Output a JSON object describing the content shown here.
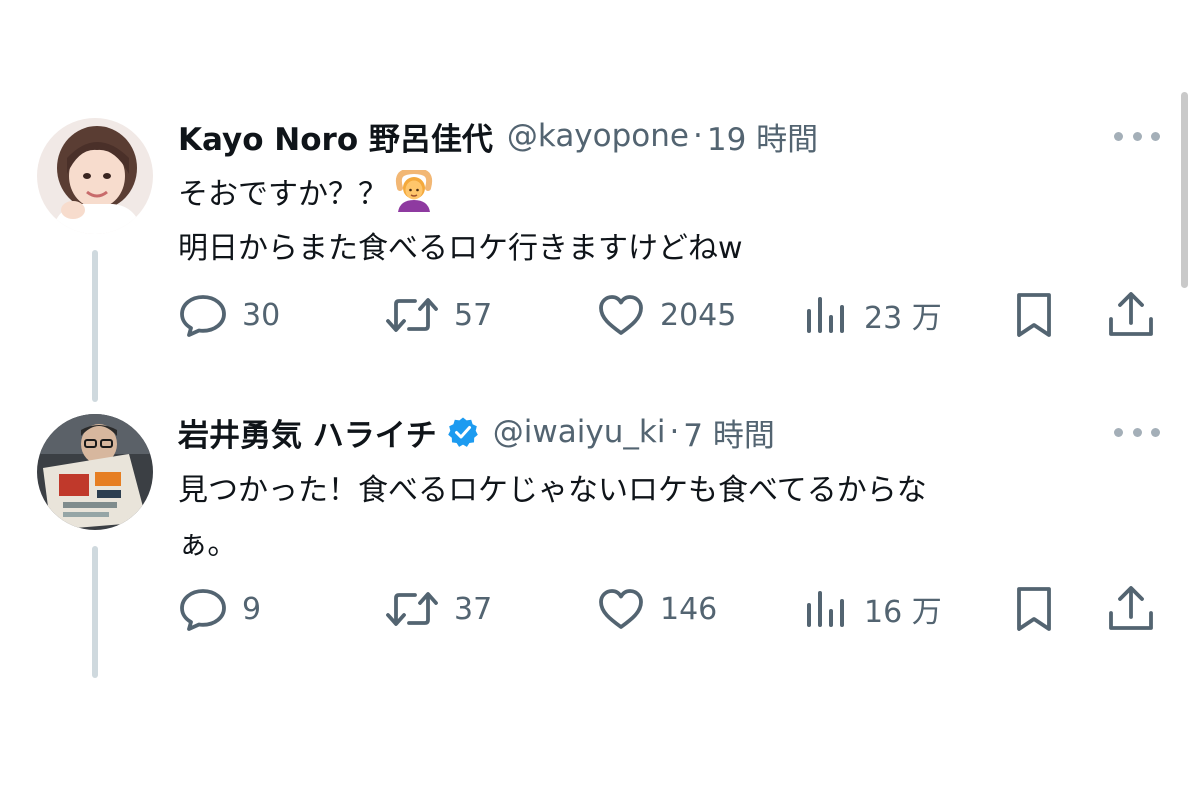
{
  "colors": {
    "text": "#0f1419",
    "secondary": "#536471",
    "verified": "#1d9bf0",
    "thread_line": "#cfd9de"
  },
  "tweets": [
    {
      "display_name": "Kayo Noro 野呂佳代",
      "handle": "@kayopone",
      "separator": "·",
      "time": "19 時間",
      "verified": false,
      "text_lines": [
        "そおですか？？",
        "明日からまた食べるロケ行きますけどねw"
      ],
      "emoji": "woman-gesturing-ok-emoji",
      "actions": {
        "replies": "30",
        "reposts": "57",
        "likes": "2045",
        "views": "23 万"
      }
    },
    {
      "display_name": "岩井勇気 ハライチ",
      "handle": "@iwaiyu_ki",
      "separator": "·",
      "time": "7 時間",
      "verified": true,
      "text_lines": [
        "見つかった！食べるロケじゃないロケも食べてるからな",
        "ぁ。"
      ],
      "actions": {
        "replies": "9",
        "reposts": "37",
        "likes": "146",
        "views": "16 万"
      }
    }
  ]
}
